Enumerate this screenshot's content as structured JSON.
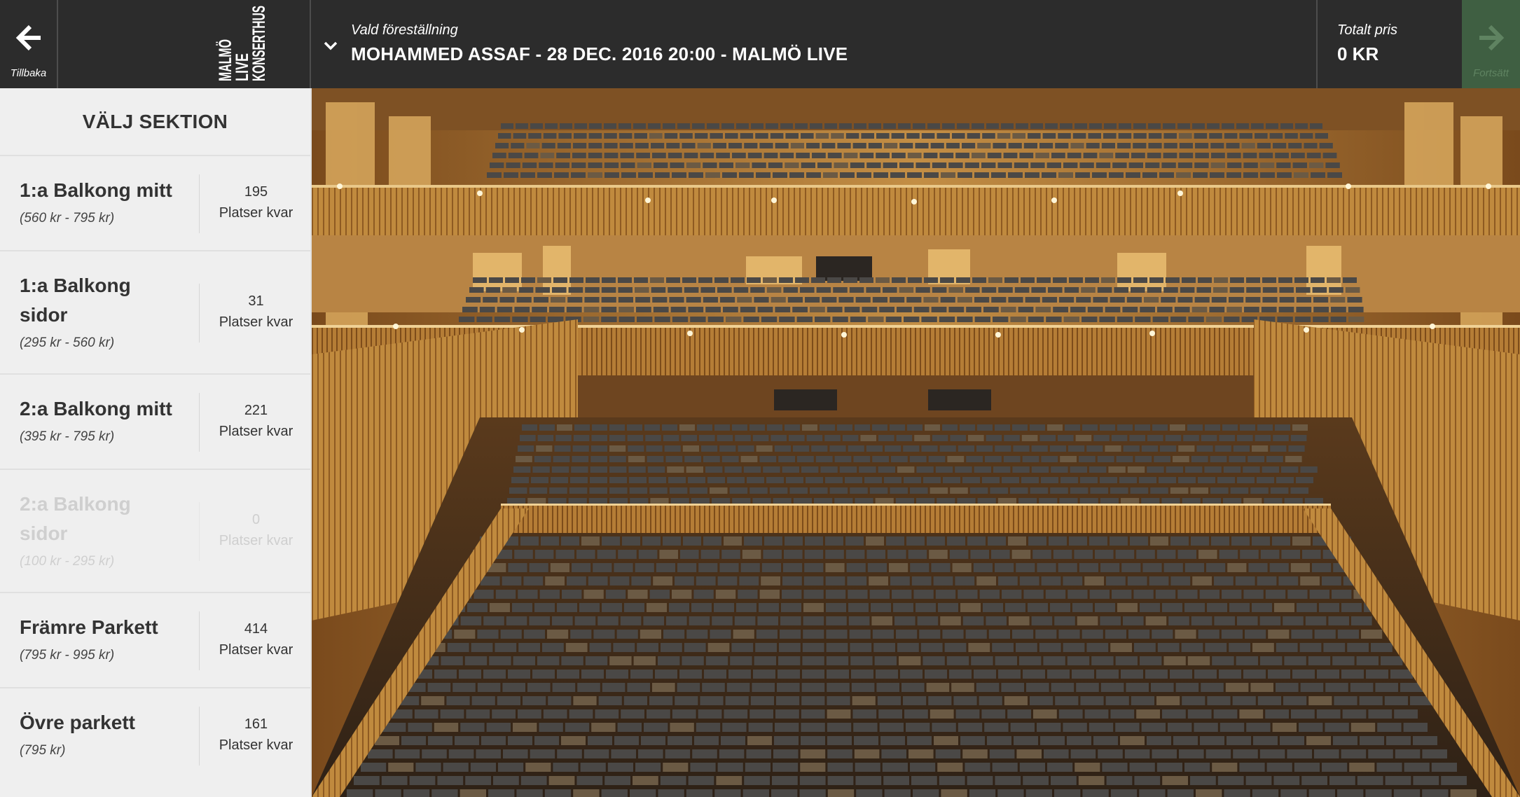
{
  "header": {
    "back_label": "Tillbaka",
    "logo_lines": [
      "MALMÖ",
      "LIVE",
      "KONSERTHUS"
    ],
    "performance_label": "Vald föreställning",
    "performance_title": "MOHAMMED ASSAF - 28 DEC. 2016 20:00 - MALMÖ LIVE",
    "total_label": "Totalt pris",
    "total_value": "0 KR",
    "continue_label": "Fortsätt"
  },
  "sidebar": {
    "heading": "VÄLJ SEKTION",
    "sections": [
      {
        "name": "1:a Balkong mitt",
        "price": "(560 kr - 795 kr)",
        "count": "195",
        "avail": "Platser kvar",
        "enabled": true
      },
      {
        "name": "1:a Balkong sidor",
        "price": "(295 kr - 560 kr)",
        "count": "31",
        "avail": "Platser kvar",
        "enabled": true
      },
      {
        "name": "2:a Balkong mitt",
        "price": "(395 kr - 795 kr)",
        "count": "221",
        "avail": "Platser kvar",
        "enabled": true
      },
      {
        "name": "2:a Balkong sidor",
        "price": "(100 kr - 295 kr)",
        "count": "0",
        "avail": "Platser kvar",
        "enabled": false
      },
      {
        "name": "Främre Parkett",
        "price": "(795 kr - 995 kr)",
        "count": "414",
        "avail": "Platser kvar",
        "enabled": true
      },
      {
        "name": "Övre parkett",
        "price": "(795 kr)",
        "count": "161",
        "avail": "Platser kvar",
        "enabled": true
      }
    ]
  },
  "colors": {
    "topbar": "#2c2c2c",
    "sidebar": "#efefef",
    "continue_bg": "#3f5f42",
    "wood": "#c8943f",
    "seat": "#4a4846"
  }
}
